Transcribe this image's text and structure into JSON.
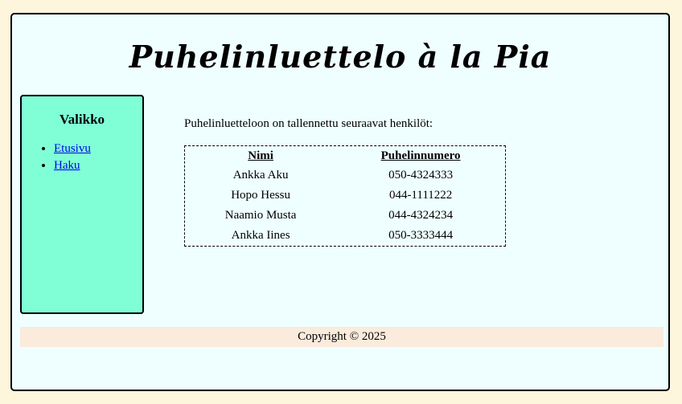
{
  "header": {
    "title": "Puhelinluettelo à la Pia"
  },
  "sidebar": {
    "title": "Valikko",
    "links": [
      {
        "label": "Etusivu"
      },
      {
        "label": "Haku"
      }
    ]
  },
  "main": {
    "intro": "Puhelinluetteloon on tallennettu seuraavat henkilöt:",
    "table": {
      "headers": [
        "Nimi",
        "Puhelinnumero"
      ],
      "rows": [
        {
          "name": "Ankka Aku",
          "phone": "050-4324333"
        },
        {
          "name": "Hopo Hessu",
          "phone": "044-1111222"
        },
        {
          "name": "Naamio Musta",
          "phone": "044-4324234"
        },
        {
          "name": "Ankka Iines",
          "phone": "050-3333444"
        }
      ]
    }
  },
  "footer": {
    "copyright": "Copyright © 2025"
  },
  "colors": {
    "page_background": "#fdf5dc",
    "frame_background": "#efffff",
    "sidebar_background": "#80ffd6",
    "footer_background": "#fbebdc",
    "link": "#0000ee"
  }
}
